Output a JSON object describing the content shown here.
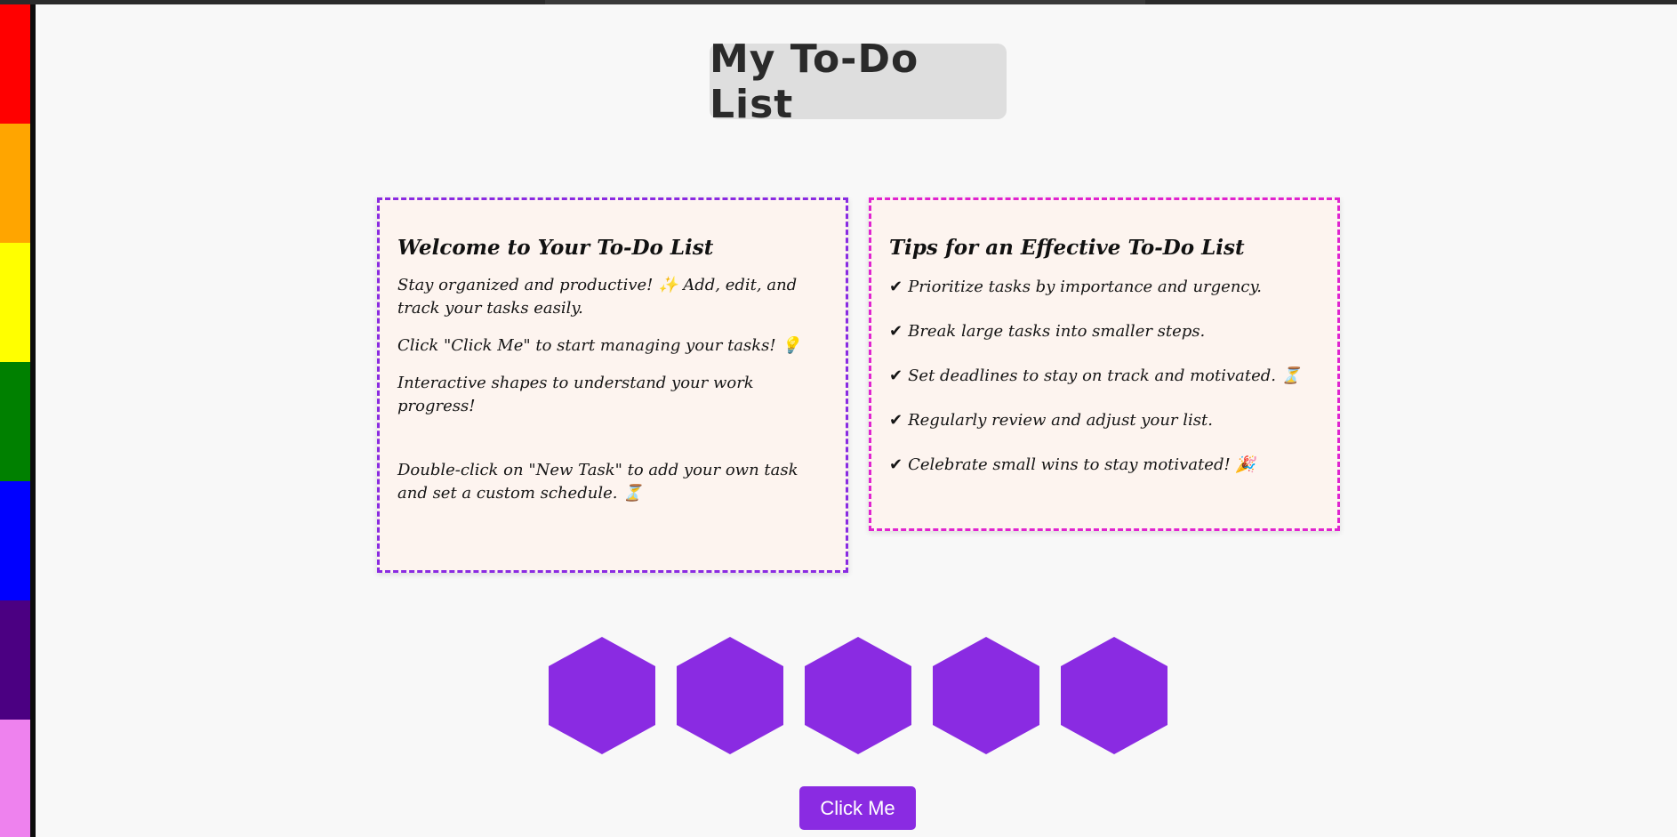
{
  "page": {
    "title": "My To-Do List"
  },
  "sidebar": {
    "stripes": [
      {
        "name": "red",
        "color": "#ff0000"
      },
      {
        "name": "orange",
        "color": "#ffa500"
      },
      {
        "name": "yellow",
        "color": "#ffff00"
      },
      {
        "name": "green",
        "color": "#008000"
      },
      {
        "name": "blue",
        "color": "#0000ff"
      },
      {
        "name": "indigo",
        "color": "#4b0082"
      },
      {
        "name": "violet",
        "color": "#ee82ee"
      }
    ]
  },
  "welcome_card": {
    "heading": "Welcome to Your To-Do List",
    "paragraphs": [
      "Stay organized and productive! ✨ Add, edit, and track your tasks easily.",
      "Click \"Click Me\" to start managing your tasks! 💡",
      "Interactive shapes to understand your work progress!",
      "Double-click on \"New Task\" to add your own task and set a custom schedule. ⏳"
    ],
    "border_color": "#8a2be2"
  },
  "tips_card": {
    "heading": "Tips for an Effective To-Do List",
    "check_glyph": "✔",
    "tips": [
      "Prioritize tasks by importance and urgency.",
      "Break large tasks into smaller steps.",
      "Set deadlines to stay on track and motivated. ⏳",
      "Regularly review and adjust your list.",
      "Celebrate small wins to stay motivated! 🎉"
    ],
    "border_color": "#e024d0"
  },
  "shapes": {
    "count": 5,
    "color": "#8a2be2"
  },
  "action_button": {
    "label": "Click Me",
    "color": "#8a2be2"
  }
}
